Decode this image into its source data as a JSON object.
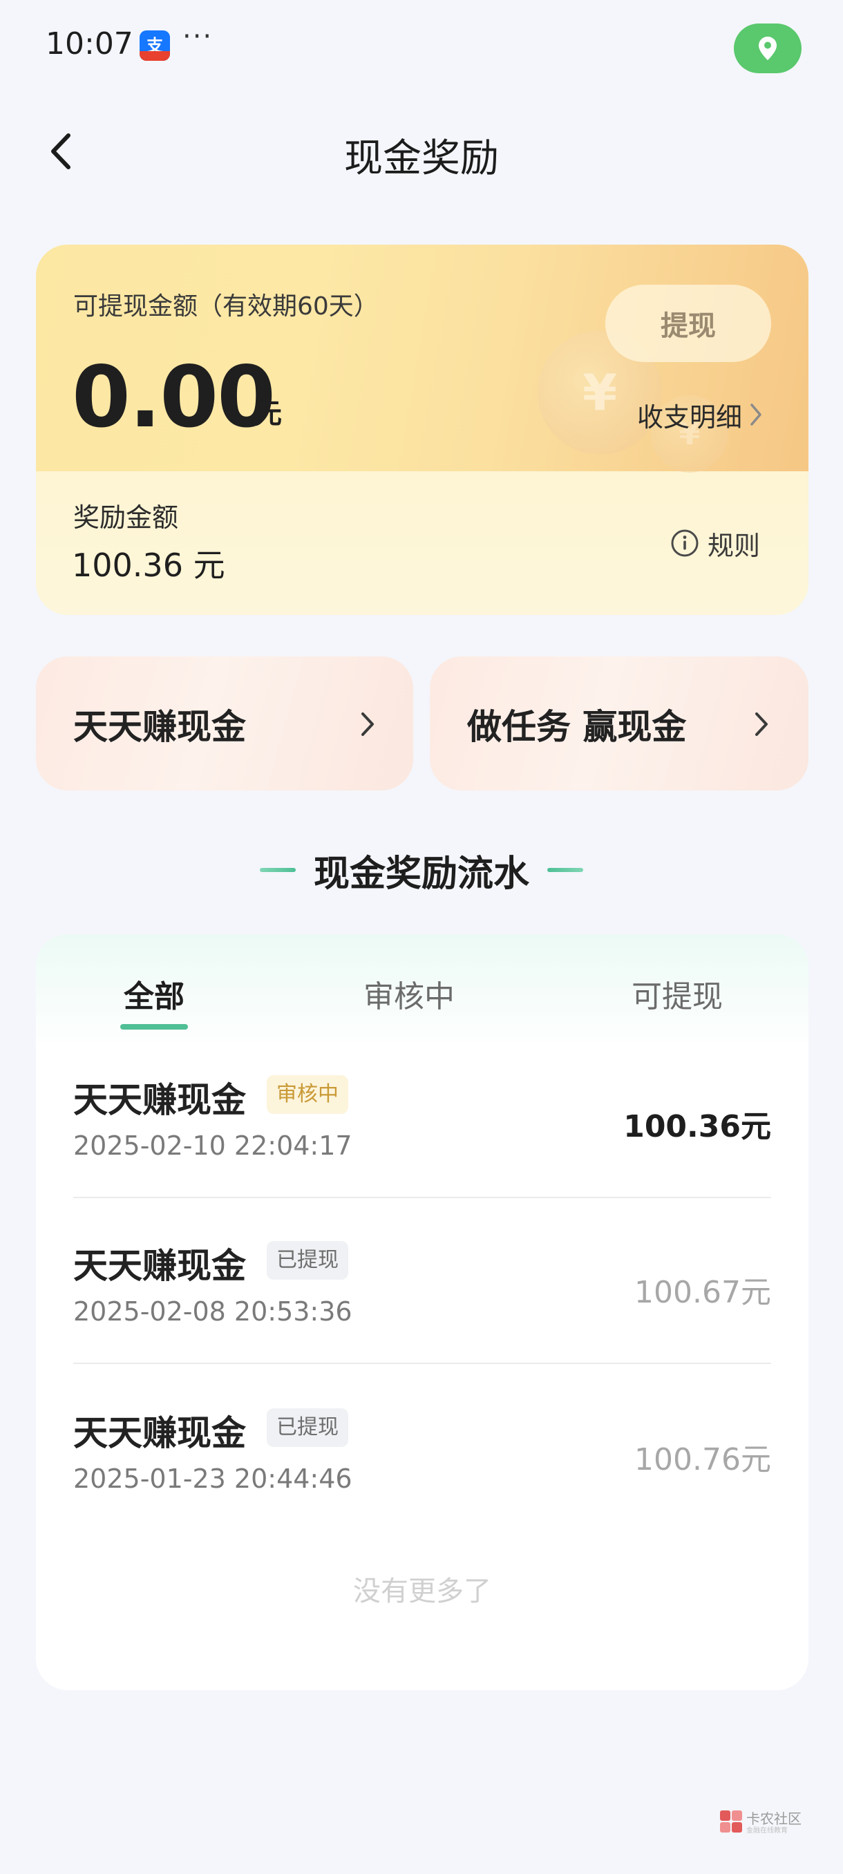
{
  "status_bar": {
    "time": "10:07",
    "app_icon": "alipay-icon",
    "app_icon_glyph": "支",
    "more": "···",
    "location_icon": "location-pin-icon"
  },
  "header": {
    "title": "现金奖励",
    "back_icon": "chevron-left-icon"
  },
  "balance_card": {
    "withdrawable_label": "可提现金额（有效期60天）",
    "withdrawable_amount": "0.00",
    "unit": "元",
    "withdraw_button": "提现",
    "detail_link": "收支明细",
    "reward_label": "奖励金额",
    "reward_amount": "100.36 元",
    "rules_link": "规则",
    "decorative_coin_glyph": "¥"
  },
  "entries": [
    {
      "label": "天天赚现金"
    },
    {
      "label": "做任务 赢现金"
    }
  ],
  "flow_section": {
    "title": "现金奖励流水",
    "tabs": [
      {
        "label": "全部",
        "active": true
      },
      {
        "label": "审核中",
        "active": false
      },
      {
        "label": "可提现",
        "active": false
      }
    ],
    "records": [
      {
        "title": "天天赚现金",
        "badge": "审核中",
        "time": "2025-02-10 22:04:17",
        "amount": "100.36元"
      },
      {
        "title": "天天赚现金",
        "badge": "已提现",
        "time": "2025-02-08 20:53:36",
        "amount": "100.67元"
      },
      {
        "title": "天天赚现金",
        "badge": "已提现",
        "time": "2025-01-23 20:44:46",
        "amount": "100.76元"
      }
    ],
    "no_more": "没有更多了"
  },
  "watermark": {
    "text": "卡农社区",
    "subtext": "金融在线教育"
  },
  "colors": {
    "accent_green": "#4fbf95",
    "location_green": "#5ac86d",
    "pending_badge_text": "#c99a36"
  }
}
